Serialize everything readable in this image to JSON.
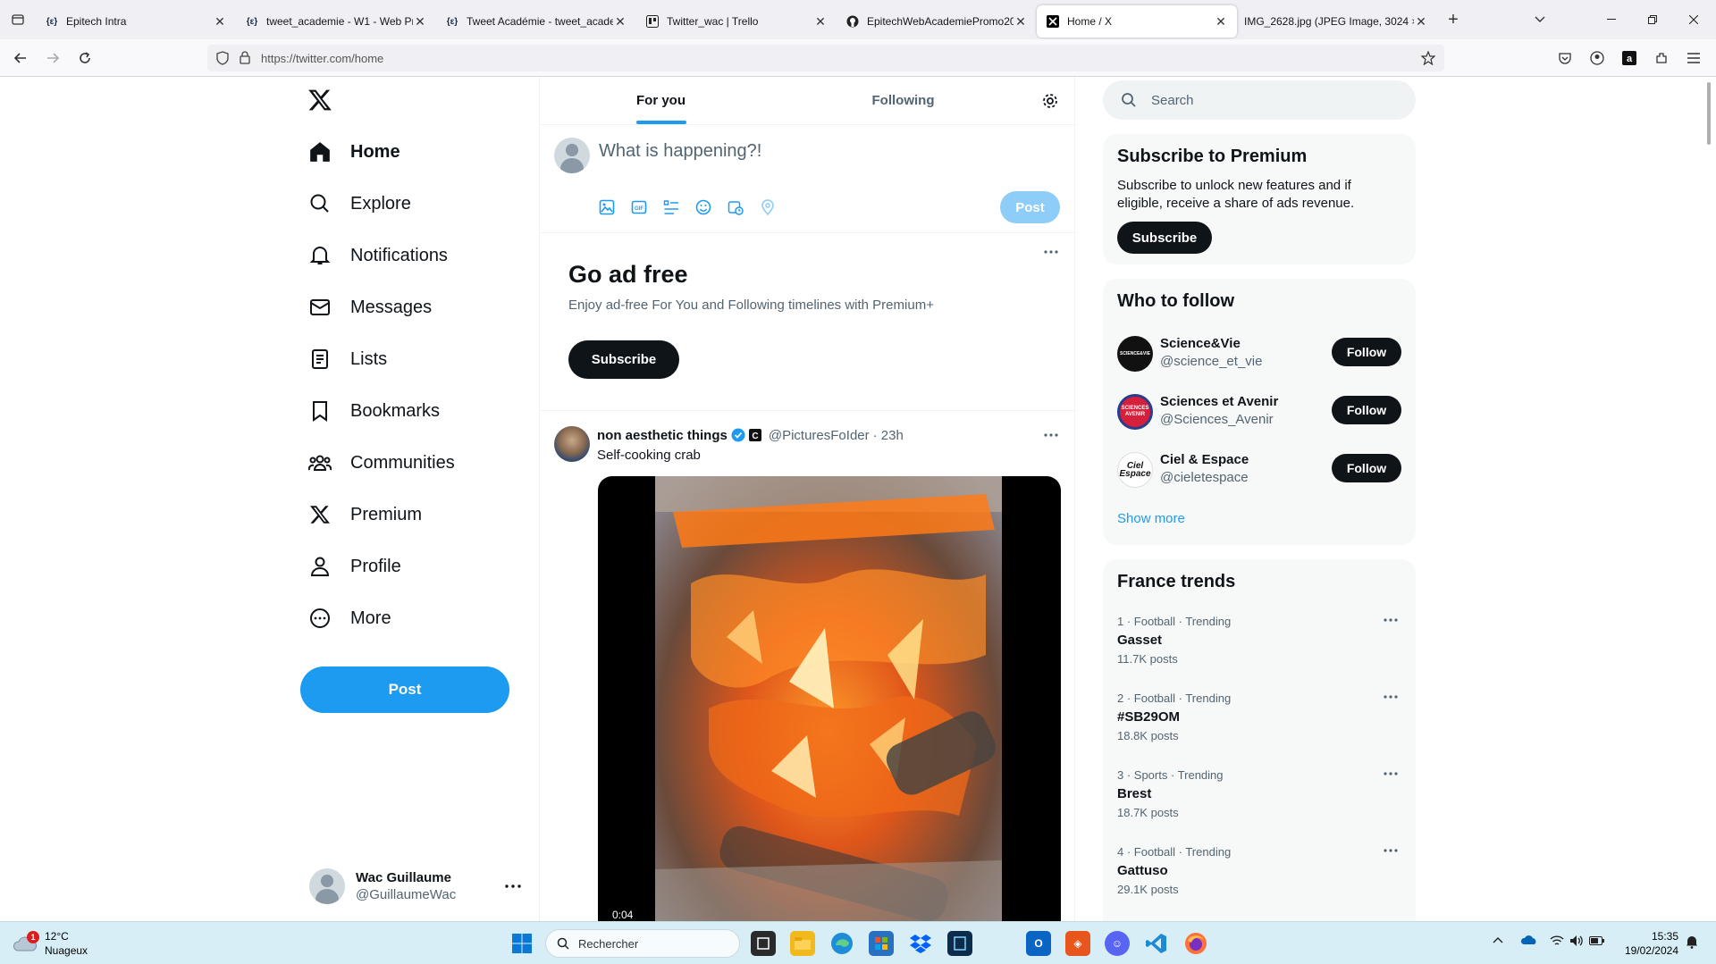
{
  "browser": {
    "tabs": [
      {
        "title": "Epitech Intra",
        "favicon": "{ε}",
        "active": false
      },
      {
        "title": "tweet_academie - W1 - Web Pr",
        "favicon": "{ε}",
        "active": false
      },
      {
        "title": "Tweet Académie - tweet_acader",
        "favicon": "{ε}",
        "active": false
      },
      {
        "title": "Twitter_wac | Trello",
        "favicon": "trello-icon",
        "active": false
      },
      {
        "title": "EpitechWebAcademiePromo20",
        "favicon": "github-icon",
        "active": false
      },
      {
        "title": "Home / X",
        "favicon": "x-icon",
        "active": true
      },
      {
        "title": "IMG_2628.jpg (JPEG Image, 3024 × 4",
        "favicon": "",
        "active": false
      }
    ],
    "url": "https://twitter.com/home"
  },
  "nav": {
    "items": [
      {
        "label": "Home",
        "icon": "home-icon",
        "active": true
      },
      {
        "label": "Explore",
        "icon": "search-icon"
      },
      {
        "label": "Notifications",
        "icon": "bell-icon"
      },
      {
        "label": "Messages",
        "icon": "mail-icon"
      },
      {
        "label": "Lists",
        "icon": "list-icon"
      },
      {
        "label": "Bookmarks",
        "icon": "bookmark-icon"
      },
      {
        "label": "Communities",
        "icon": "communities-icon"
      },
      {
        "label": "Premium",
        "icon": "x-icon"
      },
      {
        "label": "Profile",
        "icon": "person-icon"
      },
      {
        "label": "More",
        "icon": "more-circle-icon"
      }
    ],
    "post_label": "Post",
    "account": {
      "name": "Wac Guillaume",
      "handle": "@GuillaumeWac"
    }
  },
  "timeline": {
    "tabs": [
      "For you",
      "Following"
    ],
    "active_tab": "For you",
    "composer_placeholder": "What is happening?!",
    "compose_post_label": "Post",
    "ad": {
      "title": "Go ad free",
      "subtitle": "Enjoy ad-free For You and Following timelines with Premium+",
      "button": "Subscribe"
    },
    "tweet": {
      "name": "non aesthetic things",
      "handle": "@PicturesFoIder",
      "time": "· 23h",
      "text": "Self-cooking crab",
      "video_time": "0:04"
    }
  },
  "sidebar": {
    "search_placeholder": "Search",
    "premium": {
      "title": "Subscribe to Premium",
      "text": "Subscribe to unlock new features and if eligible, receive a share of ads revenue.",
      "button": "Subscribe"
    },
    "who_to_follow": {
      "title": "Who to follow",
      "accounts": [
        {
          "name": "Science&Vie",
          "handle": "@science_et_vie",
          "button": "Follow",
          "avatar_text": "SCIENCE&VIE"
        },
        {
          "name": "Sciences et Avenir",
          "handle": "@Sciences_Avenir",
          "button": "Follow",
          "avatar_text": "SCIENCES AVENIR"
        },
        {
          "name": "Ciel & Espace",
          "handle": "@cieletespace",
          "button": "Follow",
          "avatar_text": "Ciel Espace"
        }
      ],
      "show_more": "Show more"
    },
    "trends": {
      "title": "France trends",
      "items": [
        {
          "meta": "1 · Football · Trending",
          "name": "Gasset",
          "posts": "11.7K posts"
        },
        {
          "meta": "2 · Football · Trending",
          "name": "#SB29OM",
          "posts": "18.8K posts"
        },
        {
          "meta": "3 · Sports · Trending",
          "name": "Brest",
          "posts": "18.7K posts"
        },
        {
          "meta": "4 · Football · Trending",
          "name": "Gattuso",
          "posts": "29.1K posts"
        }
      ]
    }
  },
  "taskbar": {
    "weather_temp": "12°C",
    "weather_desc": "Nuageux",
    "weather_badge": "1",
    "search_placeholder": "Rechercher",
    "time": "15:35",
    "date": "19/02/2024"
  },
  "colors": {
    "accent": "#1d9bf0",
    "text": "#0f1419",
    "muted": "#536471"
  }
}
